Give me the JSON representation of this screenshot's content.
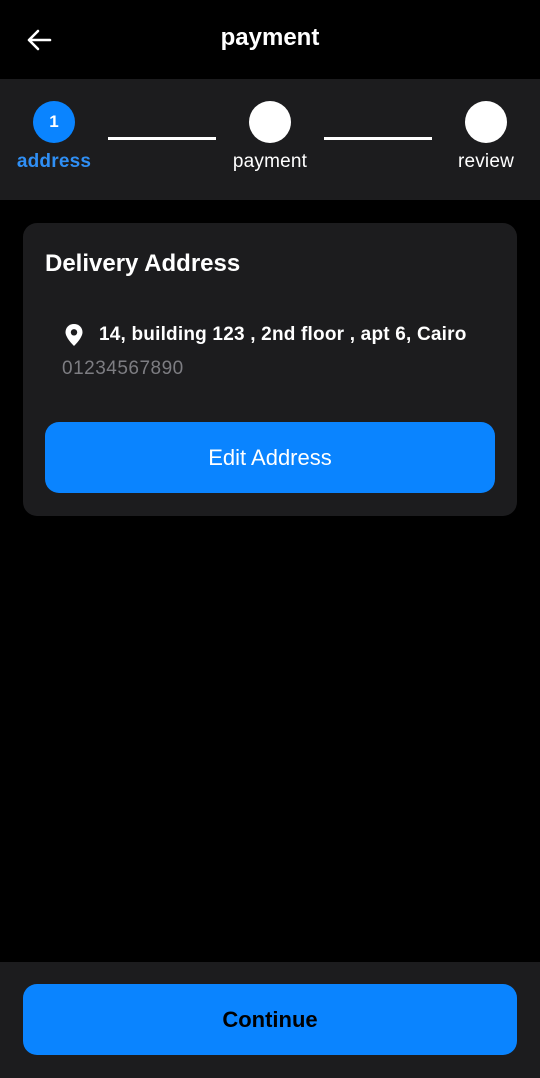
{
  "app_bar": {
    "title": "payment",
    "back_icon": "arrow-left-icon"
  },
  "stepper": {
    "steps": [
      {
        "number": "1",
        "label": "address",
        "state": "active"
      },
      {
        "number": "",
        "label": "payment",
        "state": "inactive"
      },
      {
        "number": "",
        "label": "review",
        "state": "inactive"
      }
    ],
    "active_color": "#0a84ff",
    "inactive_color": "#ffffff"
  },
  "address_card": {
    "title": "Delivery Address",
    "location_icon": "location-pin-icon",
    "address": "14, building 123 , 2nd floor , apt 6, Cairo",
    "phone": "01234567890",
    "edit_button_label": "Edit Address"
  },
  "footer": {
    "continue_label": "Continue"
  },
  "colors": {
    "background": "#000000",
    "surface": "#1c1c1e",
    "accent": "#0a84ff",
    "muted_text": "#7d7d82"
  }
}
